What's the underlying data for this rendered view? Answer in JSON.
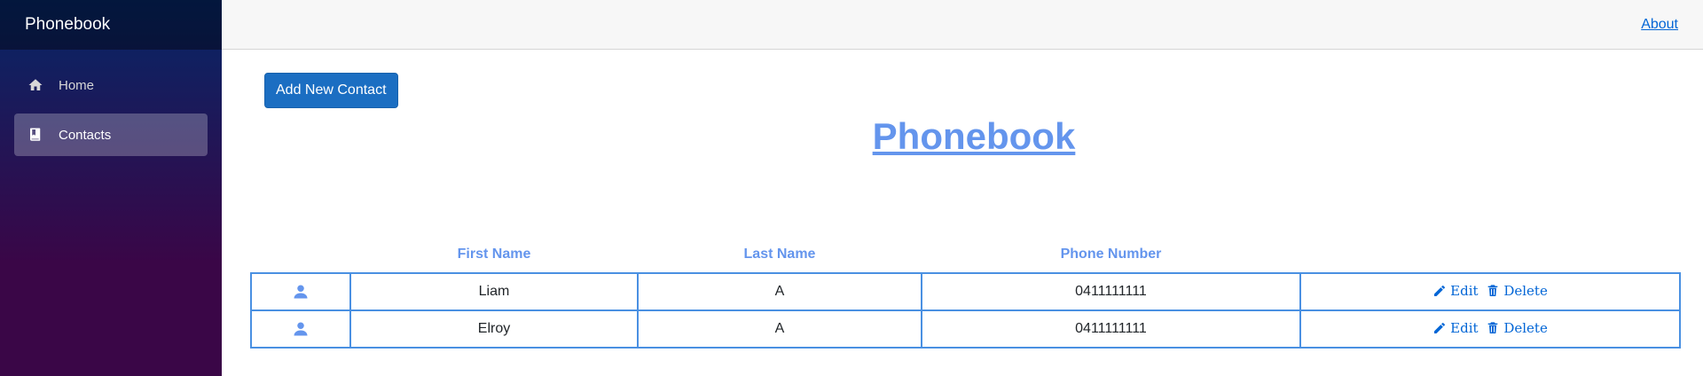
{
  "brand": {
    "title": "Phonebook"
  },
  "sidebar": {
    "items": [
      {
        "label": "Home",
        "icon": "home-icon",
        "active": false
      },
      {
        "label": "Contacts",
        "icon": "book-icon",
        "active": true
      }
    ]
  },
  "top_row": {
    "about_label": "About"
  },
  "main": {
    "add_button_label": "Add New Contact",
    "page_title": "Phonebook",
    "table": {
      "headers": [
        "",
        "First Name",
        "Last Name",
        "Phone Number",
        ""
      ],
      "rows": [
        {
          "first_name": "Liam",
          "last_name": "A",
          "phone": "0411111111",
          "edit_label": "Edit",
          "delete_label": "Delete"
        },
        {
          "first_name": "Elroy",
          "last_name": "A",
          "phone": "0411111111",
          "edit_label": "Edit",
          "delete_label": "Delete"
        }
      ]
    }
  },
  "colors": {
    "accent": "#6495ed",
    "button": "#1b6ec2",
    "link": "#0366d6",
    "table_border": "#4a90e2"
  }
}
